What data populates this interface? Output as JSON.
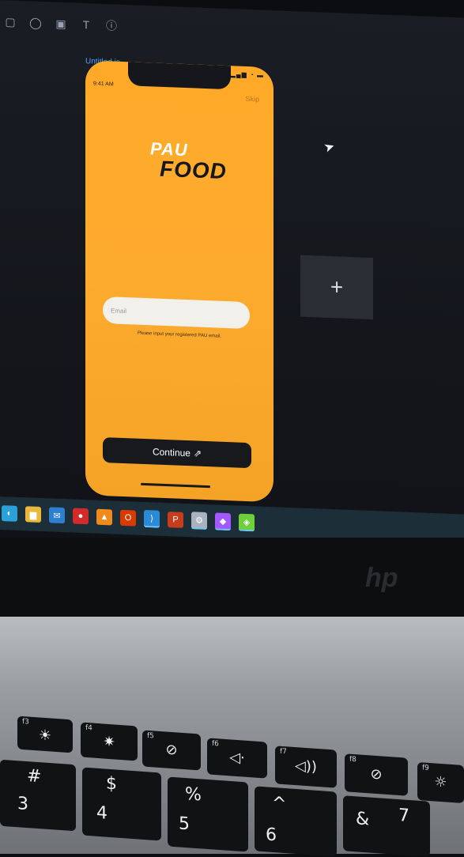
{
  "editor": {
    "tools": [
      "rect-icon",
      "circle-icon",
      "image-icon",
      "text-icon",
      "info-icon"
    ],
    "tool_glyphs": [
      "▢",
      "◯",
      "▣",
      "T",
      "ⓘ"
    ],
    "file_tab": "Untitled.js",
    "add_card_label": "+"
  },
  "phone": {
    "status_time": "9:41 AM",
    "status_icons": "▂▄▆ ◔ ▬",
    "skip_label": "Skip",
    "logo_top": "PAU",
    "logo_bottom": "FOOD",
    "email_placeholder": "Email",
    "email_hint": "Please input your registered PAU email.",
    "continue_label": "Continue",
    "continue_icon": "⇗"
  },
  "taskbar": {
    "items": [
      {
        "name": "edge-icon",
        "glyph": "◐",
        "color": "#2aa1d9"
      },
      {
        "name": "file-explorer-icon",
        "glyph": "▆",
        "color": "#e8b93a"
      },
      {
        "name": "mail-icon",
        "glyph": "✉",
        "color": "#2d7fd0"
      },
      {
        "name": "record-icon",
        "glyph": "●",
        "color": "#d32a2a"
      },
      {
        "name": "vlc-icon",
        "glyph": "▲",
        "color": "#f08a1c"
      },
      {
        "name": "office-icon",
        "glyph": "O",
        "color": "#d83b01"
      },
      {
        "name": "vscode-icon",
        "glyph": "⟩",
        "color": "#2b8ad6"
      },
      {
        "name": "powerpoint-icon",
        "glyph": "P",
        "color": "#c43e1c"
      },
      {
        "name": "settings-icon",
        "glyph": "⚙",
        "color": "#aab2bd"
      },
      {
        "name": "figma-icon",
        "glyph": "◆",
        "color": "#a259ff"
      },
      {
        "name": "bluestacks-icon",
        "glyph": "◈",
        "color": "#6fcf3a"
      }
    ]
  },
  "keyboard": {
    "f3": {
      "sub": "f3",
      "sym": "☀"
    },
    "f4": {
      "sub": "f4",
      "sym": "✷"
    },
    "f5": {
      "sub": "f5",
      "sym": "⊘"
    },
    "f6": {
      "sub": "f6",
      "sym": "◁·"
    },
    "f7": {
      "sub": "f7",
      "sym": "◁))"
    },
    "f8": {
      "sub": "f8",
      "sym": "⊘"
    },
    "f9": {
      "sub": "f9",
      "sym": "☼"
    },
    "k3": {
      "top": "#",
      "main": "3"
    },
    "k4": {
      "top": "$",
      "main": "4"
    },
    "k5": {
      "top": "%",
      "main": "5"
    },
    "k6": {
      "top": "^",
      "main": "6"
    },
    "k7": {
      "top": "&",
      "main": "7"
    }
  },
  "brand": {
    "laptop_logo": "hp"
  }
}
